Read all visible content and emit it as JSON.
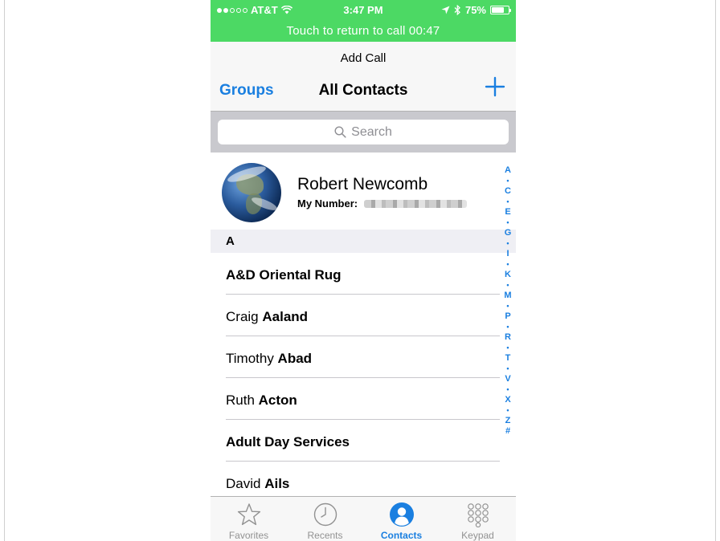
{
  "status_bar": {
    "carrier": "AT&T",
    "time": "3:47 PM",
    "battery": "75%",
    "battery_level": 0.75,
    "call_banner": "Touch to return to call 00:47"
  },
  "nav": {
    "prompt": "Add Call",
    "groups_label": "Groups",
    "title": "All Contacts",
    "add_symbol": "+"
  },
  "search": {
    "placeholder": "Search"
  },
  "my_card": {
    "name": "Robert Newcomb",
    "number_label": "My Number:"
  },
  "section": {
    "letter": "A"
  },
  "contacts": [
    {
      "first": "",
      "last": "A&D Oriental Rug"
    },
    {
      "first": "Craig ",
      "last": "Aaland"
    },
    {
      "first": "Timothy ",
      "last": "Abad"
    },
    {
      "first": "Ruth ",
      "last": "Acton"
    },
    {
      "first": "",
      "last": "Adult Day Services"
    },
    {
      "first": "David ",
      "last": "Ails"
    }
  ],
  "index": [
    "A",
    "•",
    "C",
    "•",
    "E",
    "•",
    "G",
    "•",
    "I",
    "•",
    "K",
    "•",
    "M",
    "•",
    "P",
    "•",
    "R",
    "•",
    "T",
    "•",
    "V",
    "•",
    "X",
    "•",
    "Z",
    "#"
  ],
  "tabs": [
    {
      "label": "Favorites",
      "icon": "star-icon"
    },
    {
      "label": "Recents",
      "icon": "clock-icon"
    },
    {
      "label": "Contacts",
      "icon": "person-icon"
    },
    {
      "label": "Keypad",
      "icon": "keypad-icon"
    }
  ],
  "colors": {
    "accent": "#1a7fe0",
    "call_bar": "#4cd964",
    "inactive": "#929292"
  }
}
